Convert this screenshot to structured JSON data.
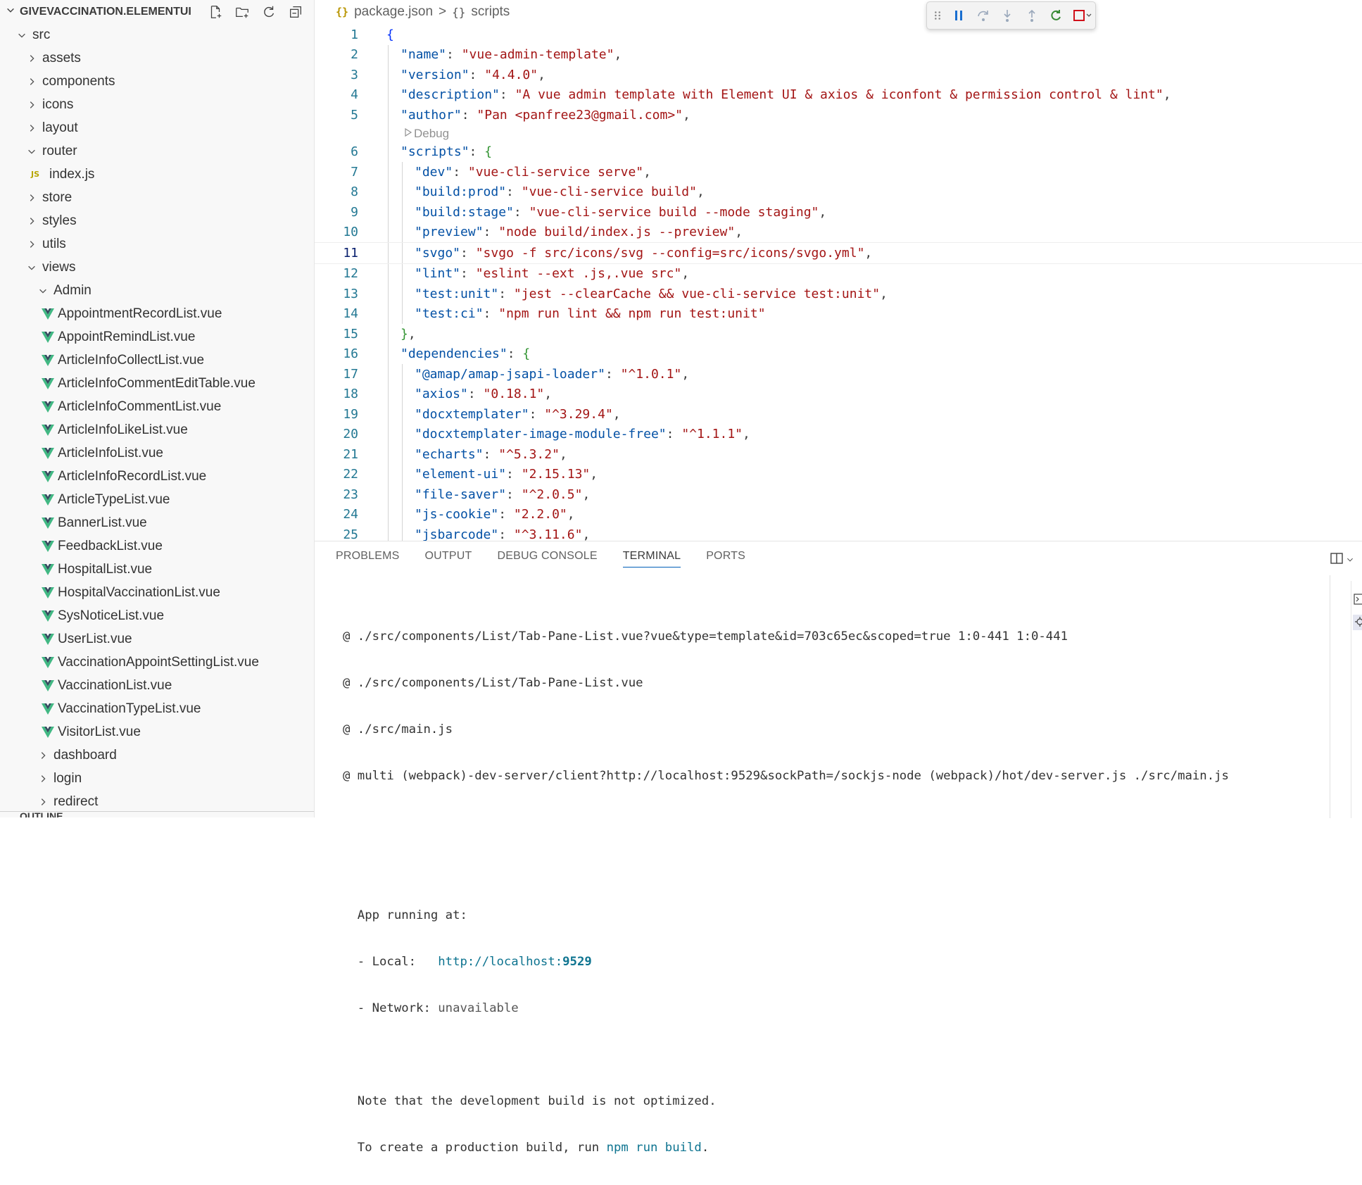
{
  "explorer": {
    "title": "GIVEVACCINATION.ELEMENTUI",
    "actions": [
      "new-file",
      "new-folder",
      "refresh",
      "collapse-all"
    ],
    "tree": [
      {
        "label": "src",
        "kind": "folder",
        "open": true,
        "depth": 0
      },
      {
        "label": "assets",
        "kind": "folder",
        "open": false,
        "depth": 1
      },
      {
        "label": "components",
        "kind": "folder",
        "open": false,
        "depth": 1
      },
      {
        "label": "icons",
        "kind": "folder",
        "open": false,
        "depth": 1
      },
      {
        "label": "layout",
        "kind": "folder",
        "open": false,
        "depth": 1
      },
      {
        "label": "router",
        "kind": "folder",
        "open": true,
        "depth": 1
      },
      {
        "label": "index.js",
        "kind": "js",
        "depth": 2
      },
      {
        "label": "store",
        "kind": "folder",
        "open": false,
        "depth": 1
      },
      {
        "label": "styles",
        "kind": "folder",
        "open": false,
        "depth": 1
      },
      {
        "label": "utils",
        "kind": "folder",
        "open": false,
        "depth": 1
      },
      {
        "label": "views",
        "kind": "folder",
        "open": true,
        "depth": 1
      },
      {
        "label": "Admin",
        "kind": "folder",
        "open": true,
        "depth": 2
      },
      {
        "label": "AppointmentRecordList.vue",
        "kind": "vue",
        "depth": 3
      },
      {
        "label": "AppointRemindList.vue",
        "kind": "vue",
        "depth": 3
      },
      {
        "label": "ArticleInfoCollectList.vue",
        "kind": "vue",
        "depth": 3
      },
      {
        "label": "ArticleInfoCommentEditTable.vue",
        "kind": "vue",
        "depth": 3
      },
      {
        "label": "ArticleInfoCommentList.vue",
        "kind": "vue",
        "depth": 3
      },
      {
        "label": "ArticleInfoLikeList.vue",
        "kind": "vue",
        "depth": 3
      },
      {
        "label": "ArticleInfoList.vue",
        "kind": "vue",
        "depth": 3
      },
      {
        "label": "ArticleInfoRecordList.vue",
        "kind": "vue",
        "depth": 3
      },
      {
        "label": "ArticleTypeList.vue",
        "kind": "vue",
        "depth": 3
      },
      {
        "label": "BannerList.vue",
        "kind": "vue",
        "depth": 3
      },
      {
        "label": "FeedbackList.vue",
        "kind": "vue",
        "depth": 3
      },
      {
        "label": "HospitalList.vue",
        "kind": "vue",
        "depth": 3
      },
      {
        "label": "HospitalVaccinationList.vue",
        "kind": "vue",
        "depth": 3
      },
      {
        "label": "SysNoticeList.vue",
        "kind": "vue",
        "depth": 3
      },
      {
        "label": "UserList.vue",
        "kind": "vue",
        "depth": 3
      },
      {
        "label": "VaccinationAppointSettingList.vue",
        "kind": "vue",
        "depth": 3
      },
      {
        "label": "VaccinationList.vue",
        "kind": "vue",
        "depth": 3
      },
      {
        "label": "VaccinationTypeList.vue",
        "kind": "vue",
        "depth": 3
      },
      {
        "label": "VisitorList.vue",
        "kind": "vue",
        "depth": 3
      },
      {
        "label": "dashboard",
        "kind": "folder",
        "open": false,
        "depth": 2
      },
      {
        "label": "login",
        "kind": "folder",
        "open": false,
        "depth": 2
      },
      {
        "label": "redirect",
        "kind": "folder",
        "open": false,
        "depth": 2
      }
    ],
    "outline_label": "OUTLINE"
  },
  "editor": {
    "breadcrumb": {
      "file_icon": "{}",
      "file": "package.json",
      "separator": ">",
      "symbol_icon": "{}",
      "symbol": "scripts"
    },
    "debug_toolbar": [
      "drag-handle",
      "pause",
      "step-over",
      "step-into",
      "step-out",
      "restart",
      "stop",
      "dropdown"
    ],
    "current_line": 11,
    "codelens": {
      "after_line": 5,
      "label": "Debug"
    },
    "lines": [
      {
        "n": "1",
        "indent": 0,
        "tokens": [
          [
            "b",
            "{"
          ]
        ]
      },
      {
        "n": "2",
        "indent": 1,
        "tokens": [
          [
            "k",
            "\"name\""
          ],
          [
            "p",
            ": "
          ],
          [
            "s",
            "\"vue-admin-template\""
          ],
          [
            "p",
            ","
          ]
        ]
      },
      {
        "n": "3",
        "indent": 1,
        "tokens": [
          [
            "k",
            "\"version\""
          ],
          [
            "p",
            ": "
          ],
          [
            "s",
            "\"4.4.0\""
          ],
          [
            "p",
            ","
          ]
        ]
      },
      {
        "n": "4",
        "indent": 1,
        "tokens": [
          [
            "k",
            "\"description\""
          ],
          [
            "p",
            ": "
          ],
          [
            "s",
            "\"A vue admin template with Element UI & axios & iconfont & permission control & lint\""
          ],
          [
            "p",
            ","
          ]
        ]
      },
      {
        "n": "5",
        "indent": 1,
        "tokens": [
          [
            "k",
            "\"author\""
          ],
          [
            "p",
            ": "
          ],
          [
            "s",
            "\"Pan <panfree23@gmail.com>\""
          ],
          [
            "p",
            ","
          ]
        ]
      },
      {
        "n": "6",
        "indent": 1,
        "tokens": [
          [
            "k",
            "\"scripts\""
          ],
          [
            "p",
            ": "
          ],
          [
            "b2",
            "{"
          ]
        ]
      },
      {
        "n": "7",
        "indent": 2,
        "tokens": [
          [
            "k",
            "\"dev\""
          ],
          [
            "p",
            ": "
          ],
          [
            "s",
            "\"vue-cli-service serve\""
          ],
          [
            "p",
            ","
          ]
        ]
      },
      {
        "n": "8",
        "indent": 2,
        "tokens": [
          [
            "k",
            "\"build:prod\""
          ],
          [
            "p",
            ": "
          ],
          [
            "s",
            "\"vue-cli-service build\""
          ],
          [
            "p",
            ","
          ]
        ]
      },
      {
        "n": "9",
        "indent": 2,
        "tokens": [
          [
            "k",
            "\"build:stage\""
          ],
          [
            "p",
            ": "
          ],
          [
            "s",
            "\"vue-cli-service build --mode staging\""
          ],
          [
            "p",
            ","
          ]
        ]
      },
      {
        "n": "10",
        "indent": 2,
        "tokens": [
          [
            "k",
            "\"preview\""
          ],
          [
            "p",
            ": "
          ],
          [
            "s",
            "\"node build/index.js --preview\""
          ],
          [
            "p",
            ","
          ]
        ]
      },
      {
        "n": "11",
        "indent": 2,
        "tokens": [
          [
            "k",
            "\"svgo\""
          ],
          [
            "p",
            ": "
          ],
          [
            "s",
            "\"svgo -f src/icons/svg --config=src/icons/svgo.yml\""
          ],
          [
            "p",
            ","
          ]
        ]
      },
      {
        "n": "12",
        "indent": 2,
        "tokens": [
          [
            "k",
            "\"lint\""
          ],
          [
            "p",
            ": "
          ],
          [
            "s",
            "\"eslint --ext .js,.vue src\""
          ],
          [
            "p",
            ","
          ]
        ]
      },
      {
        "n": "13",
        "indent": 2,
        "tokens": [
          [
            "k",
            "\"test:unit\""
          ],
          [
            "p",
            ": "
          ],
          [
            "s",
            "\"jest --clearCache && vue-cli-service test:unit\""
          ],
          [
            "p",
            ","
          ]
        ]
      },
      {
        "n": "14",
        "indent": 2,
        "tokens": [
          [
            "k",
            "\"test:ci\""
          ],
          [
            "p",
            ": "
          ],
          [
            "s",
            "\"npm run lint && npm run test:unit\""
          ]
        ]
      },
      {
        "n": "15",
        "indent": 1,
        "tokens": [
          [
            "b2",
            "}"
          ],
          [
            "p",
            ","
          ]
        ]
      },
      {
        "n": "16",
        "indent": 1,
        "tokens": [
          [
            "k",
            "\"dependencies\""
          ],
          [
            "p",
            ": "
          ],
          [
            "b2",
            "{"
          ]
        ]
      },
      {
        "n": "17",
        "indent": 2,
        "tokens": [
          [
            "k",
            "\"@amap/amap-jsapi-loader\""
          ],
          [
            "p",
            ": "
          ],
          [
            "s",
            "\"^1.0.1\""
          ],
          [
            "p",
            ","
          ]
        ]
      },
      {
        "n": "18",
        "indent": 2,
        "tokens": [
          [
            "k",
            "\"axios\""
          ],
          [
            "p",
            ": "
          ],
          [
            "s",
            "\"0.18.1\""
          ],
          [
            "p",
            ","
          ]
        ]
      },
      {
        "n": "19",
        "indent": 2,
        "tokens": [
          [
            "k",
            "\"docxtemplater\""
          ],
          [
            "p",
            ": "
          ],
          [
            "s",
            "\"^3.29.4\""
          ],
          [
            "p",
            ","
          ]
        ]
      },
      {
        "n": "20",
        "indent": 2,
        "tokens": [
          [
            "k",
            "\"docxtemplater-image-module-free\""
          ],
          [
            "p",
            ": "
          ],
          [
            "s",
            "\"^1.1.1\""
          ],
          [
            "p",
            ","
          ]
        ]
      },
      {
        "n": "21",
        "indent": 2,
        "tokens": [
          [
            "k",
            "\"echarts\""
          ],
          [
            "p",
            ": "
          ],
          [
            "s",
            "\"^5.3.2\""
          ],
          [
            "p",
            ","
          ]
        ]
      },
      {
        "n": "22",
        "indent": 2,
        "tokens": [
          [
            "k",
            "\"element-ui\""
          ],
          [
            "p",
            ": "
          ],
          [
            "s",
            "\"2.15.13\""
          ],
          [
            "p",
            ","
          ]
        ]
      },
      {
        "n": "23",
        "indent": 2,
        "tokens": [
          [
            "k",
            "\"file-saver\""
          ],
          [
            "p",
            ": "
          ],
          [
            "s",
            "\"^2.0.5\""
          ],
          [
            "p",
            ","
          ]
        ]
      },
      {
        "n": "24",
        "indent": 2,
        "tokens": [
          [
            "k",
            "\"js-cookie\""
          ],
          [
            "p",
            ": "
          ],
          [
            "s",
            "\"2.2.0\""
          ],
          [
            "p",
            ","
          ]
        ]
      },
      {
        "n": "25",
        "indent": 2,
        "tokens": [
          [
            "k",
            "\"jsbarcode\""
          ],
          [
            "p",
            ": "
          ],
          [
            "s",
            "\"^3.11.6\""
          ],
          [
            "p",
            ","
          ]
        ]
      }
    ]
  },
  "panel": {
    "tabs": [
      "PROBLEMS",
      "OUTPUT",
      "DEBUG CONSOLE",
      "TERMINAL",
      "PORTS"
    ],
    "active_tab": "TERMINAL",
    "terminal": {
      "lines": [
        "@ ./src/components/List/Tab-Pane-List.vue?vue&type=template&id=703c65ec&scoped=true 1:0-441 1:0-441",
        "@ ./src/components/List/Tab-Pane-List.vue",
        "@ ./src/main.js",
        "@ multi (webpack)-dev-server/client?http://localhost:9529&sockPath=/sockjs-node (webpack)/hot/dev-server.js ./src/main.js",
        "",
        "",
        "  App running at:",
        "  - Local:   ",
        "  - Network: ",
        "",
        "  Note that the development build is not optimized.",
        "  To create a production build, run "
      ],
      "local_url_prefix": "http://localhost:",
      "local_url_port": "9529",
      "network_value": "unavailable",
      "build_command": "npm run build",
      "build_suffix": "."
    }
  },
  "colors": {
    "key": "#0451a5",
    "string": "#a31515",
    "brace": "#0431fa",
    "brace_nested": "#319331",
    "line_number": "#237893",
    "vue_icon": "#41b883",
    "accent": "#005fb8",
    "terminal_link": "#0e7490"
  }
}
